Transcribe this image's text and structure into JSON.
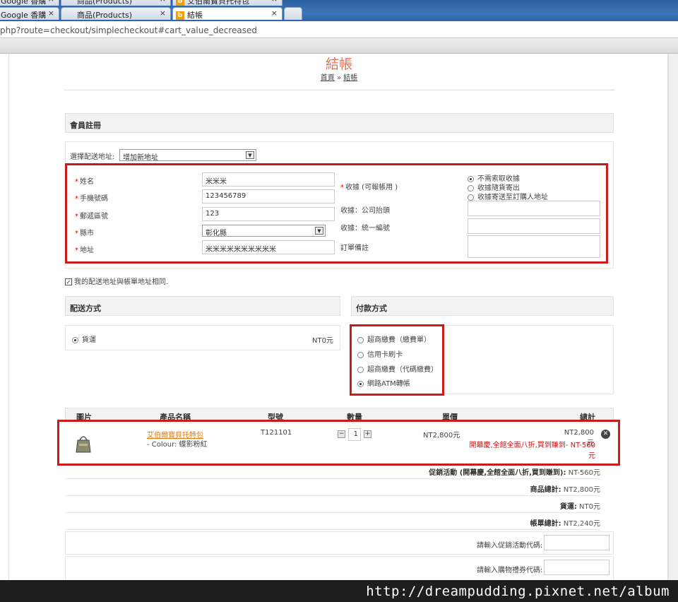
{
  "browser": {
    "tabs_row1": [
      {
        "label": "Google 香購",
        "close": "×"
      },
      {
        "label": "商品(Products)",
        "close": "×"
      },
      {
        "label": "艾伯爾寶貝托特包",
        "close": "×"
      }
    ],
    "tabs_row2": [
      {
        "label": "Google 香購",
        "close": "×"
      },
      {
        "label": "商品(Products)",
        "close": "×"
      },
      {
        "label": "結帳",
        "close": "×",
        "favicon": "b"
      }
    ],
    "url": "php?route=checkout/simplecheckout#cart_value_decreased"
  },
  "page": {
    "title": "結帳",
    "breadcrumb": {
      "home": "首頁",
      "sep": "»",
      "current": "結帳"
    }
  },
  "member": {
    "section_title": "會員註冊",
    "address_select_label": "選擇配送地址:",
    "address_select_value": "增加新地址",
    "fields": {
      "name": {
        "label": "姓名",
        "value": "米米米"
      },
      "phone": {
        "label": "手機號碼",
        "value": "123456789"
      },
      "zip": {
        "label": "郵遞區號",
        "value": "123"
      },
      "city": {
        "label": "縣市",
        "value": "彰化縣"
      },
      "address": {
        "label": "地址",
        "value": "米米米米米米米米米米"
      }
    },
    "receipt_label": "收據 (可報帳用 )",
    "receipt_options": [
      "不需索取收據",
      "收據隨貨寄出",
      "收據寄送至訂購人地址"
    ],
    "receipt_selected": 0,
    "company_title_label": "收據：公司抬頭",
    "tax_id_label": "收據：統一編號",
    "order_note_label": "訂單備註",
    "same_address_label": "我的配送地址與帳單地址相同."
  },
  "shipping": {
    "section_title": "配送方式",
    "option_label": "貨運",
    "option_price": "NT0元"
  },
  "payment": {
    "section_title": "付款方式",
    "options": [
      "超商繳費（繳費單）",
      "信用卡刷卡",
      "超商繳費（代碼繳費）",
      "網路ATM轉帳"
    ],
    "selected": 3
  },
  "cart": {
    "headers": {
      "image": "圖片",
      "name": "產品名稱",
      "model": "型號",
      "qty": "數量",
      "price": "單價",
      "total": "總計"
    },
    "item": {
      "name": "艾伯爾寶貝托特包",
      "option": "- Colour: 蝶影粉紅",
      "model": "T121101",
      "qty": "1",
      "price": "NT2,800元",
      "total": "NT2,800元",
      "discount_note": "開幕慶,全館全面八折,買到賺到- NT-560元"
    }
  },
  "totals": [
    {
      "label": "促銷活動 (開幕慶,全館全面八折,買到賺到):",
      "value": "NT-560元"
    },
    {
      "label": "商品總計:",
      "value": "NT2,800元"
    },
    {
      "label": "貨運:",
      "value": "NT0元"
    },
    {
      "label": "帳單總計:",
      "value": "NT2,240元"
    }
  ],
  "codes": {
    "coupon_label": "請輸入促銷活動代碼:",
    "voucher_label": "請輸入購物禮券代碼:"
  },
  "watermark": "http://dreampudding.pixnet.net/album"
}
